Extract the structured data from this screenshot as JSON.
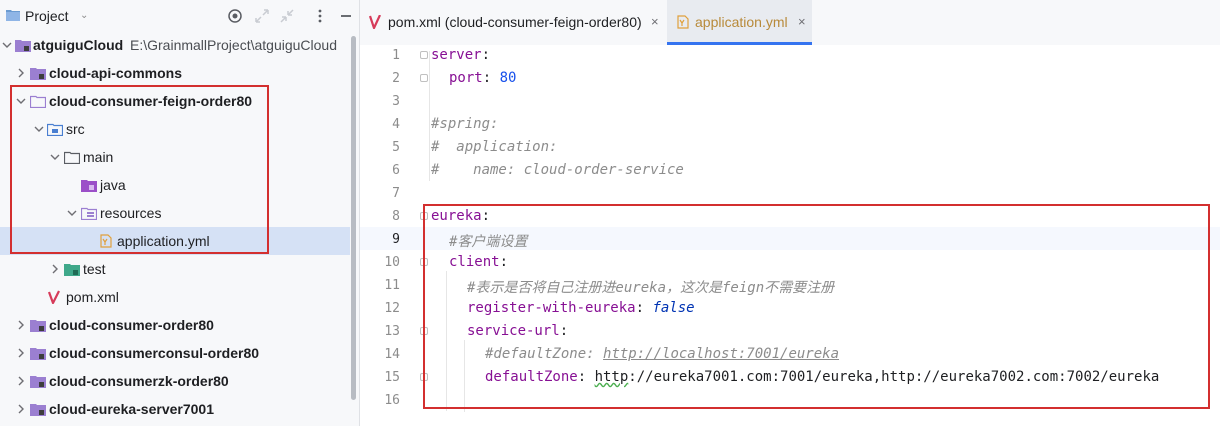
{
  "sidebar": {
    "title": "Project",
    "root": {
      "name": "atguiguCloud",
      "path": "E:\\GrainmallProject\\atguiguCloud"
    },
    "items": [
      {
        "label": "cloud-api-commons"
      },
      {
        "label": "cloud-consumer-feign-order80"
      },
      {
        "label": "src"
      },
      {
        "label": "main"
      },
      {
        "label": "java"
      },
      {
        "label": "resources"
      },
      {
        "label": "application.yml"
      },
      {
        "label": "test"
      },
      {
        "label": "pom.xml"
      },
      {
        "label": "cloud-consumer-order80"
      },
      {
        "label": "cloud-consumerconsul-order80"
      },
      {
        "label": "cloud-consumerzk-order80"
      },
      {
        "label": "cloud-eureka-server7001"
      }
    ]
  },
  "tabs": [
    {
      "label": "pom.xml (cloud-consumer-feign-order80)",
      "close": "×"
    },
    {
      "label": "application.yml",
      "close": "×"
    }
  ],
  "editor": {
    "line_numbers": [
      "1",
      "2",
      "3",
      "4",
      "5",
      "6",
      "7",
      "8",
      "9",
      "10",
      "11",
      "12",
      "13",
      "14",
      "15",
      "16"
    ],
    "lines": {
      "l1": {
        "key": "server",
        "colon": ":"
      },
      "l2": {
        "key": "port",
        "colon": ": ",
        "value": "80"
      },
      "l4": "#spring:",
      "l5": "#  application:",
      "l6": "#    name: cloud-order-service",
      "l8": {
        "key": "eureka",
        "colon": ":"
      },
      "l9": "#客户端设置",
      "l10": {
        "key": "client",
        "colon": ":"
      },
      "l11": "#表示是否将自己注册进eureka，这次是feign不需要注册",
      "l12": {
        "key": "register-with-eureka",
        "colon": ": ",
        "value": "false"
      },
      "l13": {
        "key": "service-url",
        "colon": ":"
      },
      "l14": {
        "prefix": "#defaultZone: ",
        "url": "http://localhost:7001/eureka"
      },
      "l15": {
        "key": "defaultZone",
        "colon": ": ",
        "val1": "http",
        "val2": "://eureka7001.com:7001/eureka,http://eureka7002.com:7002/eureka"
      }
    }
  },
  "colors": {
    "highlight_box": "#d32f2f",
    "selection": "#d5e1f5",
    "accent": "#3574f0"
  }
}
